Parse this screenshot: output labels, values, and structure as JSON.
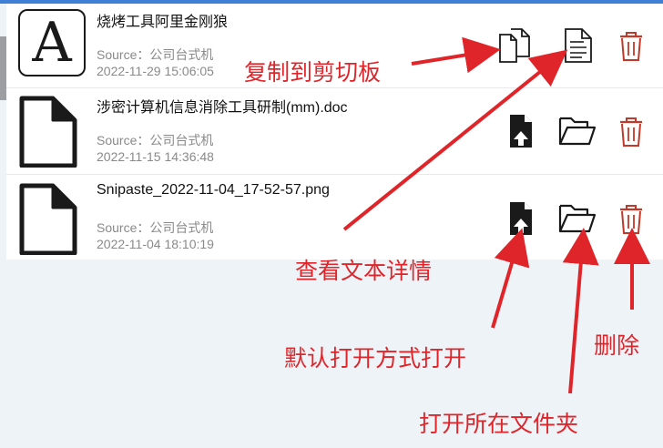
{
  "items": [
    {
      "thumb_letter": "A",
      "title": "烧烤工具阿里金刚狼",
      "source": "Source：公司台式机",
      "date": "2022-11-29 15:06:05"
    },
    {
      "title": "涉密计算机信息消除工具研制(mm).doc",
      "source": "Source：公司台式机",
      "date": "2022-11-15 14:36:48"
    },
    {
      "title": "Snipaste_2022-11-04_17-52-57.png",
      "source": "Source：公司台式机",
      "date": "2022-11-04 18:10:19"
    }
  ],
  "annotations": {
    "copy": "复制到剪切板",
    "view": "查看文本详情",
    "open_default": "默认打开方式打开",
    "delete": "删除",
    "open_folder": "打开所在文件夹"
  },
  "colors": {
    "accent": "#3f7fd6",
    "annotation": "#e0252a",
    "delete_icon": "#c0392b"
  },
  "icons": {
    "row0": [
      "copy-icon",
      "text-detail-icon",
      "delete-icon"
    ],
    "row1": [
      "open-file-icon",
      "folder-open-icon",
      "delete-icon"
    ],
    "row2": [
      "open-file-icon",
      "folder-open-icon",
      "delete-icon"
    ]
  }
}
